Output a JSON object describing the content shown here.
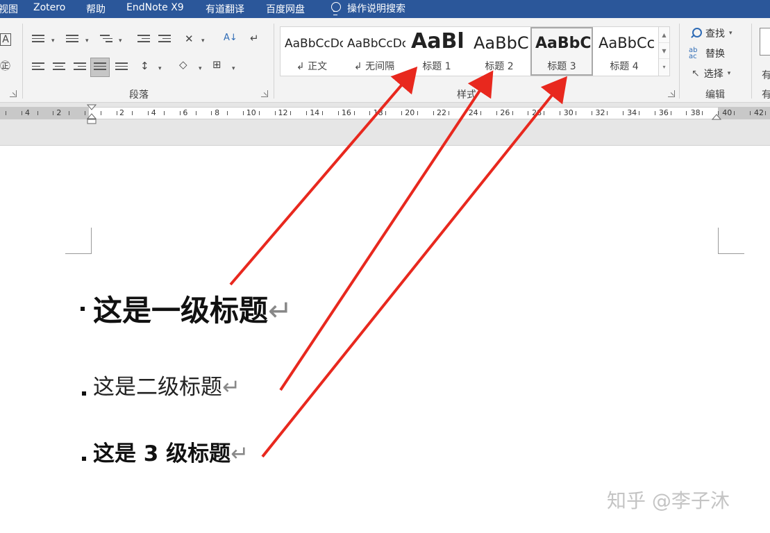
{
  "tabs": [
    "视图",
    "Zotero",
    "帮助",
    "EndNote X9",
    "有道翻译",
    "百度网盘",
    "操作说明搜索"
  ],
  "groups": {
    "paragraph": "段落",
    "styles": "样式",
    "editing": "编辑",
    "partial": "有"
  },
  "ribbon_left": {
    "font_a": "A",
    "font_circle": "㊣"
  },
  "styles": [
    {
      "preview": "AaBbCcDc",
      "name": "正文",
      "mark": "↲"
    },
    {
      "preview": "AaBbCcDc",
      "name": "无间隔",
      "mark": "↲"
    },
    {
      "preview": "AaBl",
      "name": "标题 1"
    },
    {
      "preview": "AaBbC",
      "name": "标题 2"
    },
    {
      "preview": "AaBbC",
      "name": "标题 3"
    },
    {
      "preview": "AaBbCc",
      "name": "标题 4"
    }
  ],
  "editing": {
    "find": "查找",
    "replace": "替换",
    "select": "选择",
    "partial_top": "有",
    "partial_bottom": "有"
  },
  "ruler_numbers": [
    "4",
    "2",
    "2",
    "4",
    "6",
    "8",
    "10",
    "12",
    "14",
    "16",
    "18",
    "20",
    "22",
    "24",
    "26",
    "28",
    "30",
    "32",
    "34",
    "36",
    "38",
    "40",
    "42"
  ],
  "document": {
    "heading1": "这是一级标题",
    "heading2": "这是二级标题",
    "heading3": "这是 3 级标题",
    "return_mark": "↵"
  },
  "watermark": "知乎 @李子沐",
  "colors": {
    "tabbar": "#2b579a",
    "arrow": "#e8281e"
  }
}
